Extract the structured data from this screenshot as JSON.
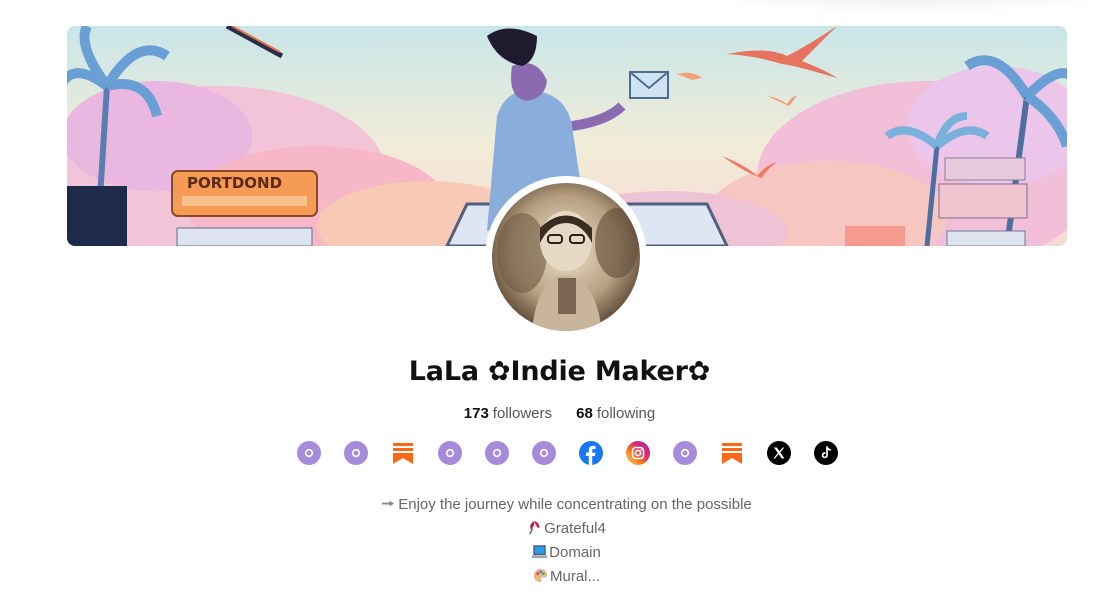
{
  "profile": {
    "name": "LaLa ✿Indie Maker✿",
    "followers_count": "173",
    "followers_label": "followers",
    "following_count": "68",
    "following_label": "following"
  },
  "banner": {
    "sign_text": "PORTDOND"
  },
  "social_links": [
    {
      "icon": "link-icon",
      "color": "#a78bdb"
    },
    {
      "icon": "link-icon",
      "color": "#a78bdb"
    },
    {
      "icon": "substack-icon",
      "color": "#ff6719"
    },
    {
      "icon": "link-icon",
      "color": "#a78bdb"
    },
    {
      "icon": "link-icon",
      "color": "#a78bdb"
    },
    {
      "icon": "link-icon",
      "color": "#a78bdb"
    },
    {
      "icon": "facebook-icon",
      "color": "#1877f2"
    },
    {
      "icon": "instagram-icon",
      "color": "#d62976"
    },
    {
      "icon": "link-icon",
      "color": "#a78bdb"
    },
    {
      "icon": "substack-icon",
      "color": "#ff6719"
    },
    {
      "icon": "x-icon",
      "color": "#000000"
    },
    {
      "icon": "tiktok-icon",
      "color": "#000000"
    }
  ],
  "bio": {
    "line1": "Enjoy the journey while concentrating on the possible",
    "line2": "Grateful4",
    "line3": "Domain",
    "line4": "Mural..."
  }
}
